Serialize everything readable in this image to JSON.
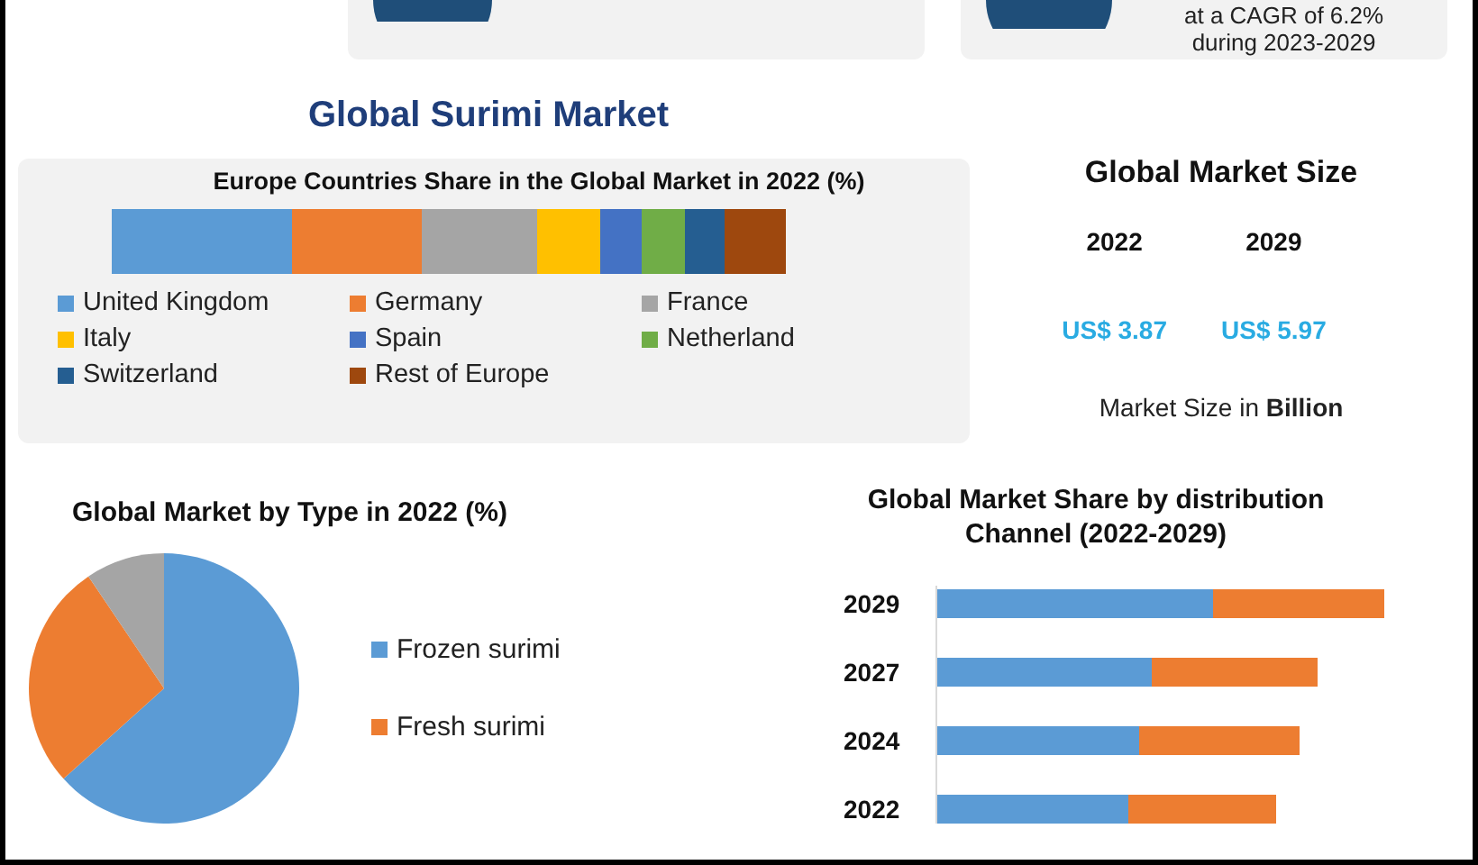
{
  "cagr_card": {
    "lines": [
      "at a CAGR of 6.2%",
      "during 2023-2029"
    ]
  },
  "title": "Global Surimi Market",
  "europe_share": {
    "title": "Europe Countries Share in the Global Market in 2022 (%)",
    "legend": [
      {
        "label": "United Kingdom",
        "color": "#5b9bd5"
      },
      {
        "label": "Germany",
        "color": "#ed7d31"
      },
      {
        "label": "France",
        "color": "#a5a5a5"
      },
      {
        "label": "Italy",
        "color": "#ffc000"
      },
      {
        "label": "Spain",
        "color": "#4472c4"
      },
      {
        "label": "Netherland",
        "color": "#70ad47"
      },
      {
        "label": "Switzerland",
        "color": "#255e91"
      },
      {
        "label": "Rest of Europe",
        "color": "#9e480e"
      }
    ]
  },
  "market_size": {
    "title": "Global Market Size",
    "columns": [
      {
        "year": "2022",
        "value": "US$ 3.87"
      },
      {
        "year": "2029",
        "value": "US$ 5.97"
      }
    ],
    "note": "Market Size in **Billion**"
  },
  "type_share": {
    "title": "Global Market by Type in 2022 (%)",
    "legend": [
      {
        "label": "Frozen surimi",
        "color": "#5b9bd5"
      },
      {
        "label": "Fresh surimi",
        "color": "#ed7d31"
      }
    ]
  },
  "distribution": {
    "title": "Global Market Share by distribution Channel (2022-2029)",
    "rows": [
      {
        "label": "2029"
      },
      {
        "label": "2027"
      },
      {
        "label": "2024"
      },
      {
        "label": "2022"
      }
    ]
  }
}
